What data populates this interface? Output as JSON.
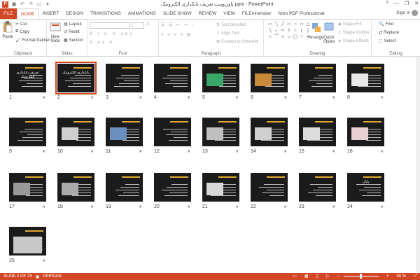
{
  "window": {
    "title": "پاورپوینت تعریف بانکداری الکترونیک.pptx - PowerPoint",
    "controls": [
      "?",
      "—",
      "❐",
      "✕"
    ]
  },
  "qat": [
    "save-icon",
    "undo-icon",
    "redo-icon",
    "start-slideshow-icon",
    "customize-icon"
  ],
  "tabs": [
    {
      "label": "FILE"
    },
    {
      "label": "HOME"
    },
    {
      "label": "INSERT"
    },
    {
      "label": "DESIGN"
    },
    {
      "label": "TRANSITIONS"
    },
    {
      "label": "ANIMATIONS"
    },
    {
      "label": "SLIDE SHOW"
    },
    {
      "label": "REVIEW"
    },
    {
      "label": "VIEW"
    },
    {
      "label": "FILEminimizer"
    },
    {
      "label": "Nitro PDF Professional"
    }
  ],
  "signin": "Sign in",
  "ribbon": {
    "clipboard": {
      "paste": "Paste",
      "cut": "Cut",
      "copy": "Copy",
      "format_painter": "Format Painter",
      "label": "Clipboard"
    },
    "slides": {
      "new_slide": "New Slide",
      "layout": "Layout",
      "reset": "Reset",
      "section": "Section",
      "label": "Slides"
    },
    "font": {
      "label": "Font"
    },
    "paragraph": {
      "text_direction": "Text Direction",
      "align_text": "Align Text",
      "convert": "Convert to SmartArt",
      "label": "Paragraph"
    },
    "drawing": {
      "arrange": "Arrange",
      "quick_styles": "Quick Styles",
      "shape_fill": "Shape Fill",
      "shape_outline": "Shape Outline",
      "shape_effects": "Shape Effects",
      "label": "Drawing"
    },
    "editing": {
      "find": "Find",
      "replace": "Replace",
      "select": "Select",
      "label": "Editing"
    }
  },
  "slides": [
    {
      "n": "1",
      "title": "تعریف بانکداری الکترونیک"
    },
    {
      "n": "2",
      "title": "بانکداری الکترونیک"
    },
    {
      "n": "3"
    },
    {
      "n": "4"
    },
    {
      "n": "5"
    },
    {
      "n": "6"
    },
    {
      "n": "7"
    },
    {
      "n": "8"
    },
    {
      "n": "9"
    },
    {
      "n": "10"
    },
    {
      "n": "11"
    },
    {
      "n": "12"
    },
    {
      "n": "13"
    },
    {
      "n": "14"
    },
    {
      "n": "15"
    },
    {
      "n": "16"
    },
    {
      "n": "17"
    },
    {
      "n": "18"
    },
    {
      "n": "19"
    },
    {
      "n": "20"
    },
    {
      "n": "21"
    },
    {
      "n": "22"
    },
    {
      "n": "23"
    },
    {
      "n": "24",
      "title": "پایان"
    },
    {
      "n": "25"
    }
  ],
  "selected_slide": 2,
  "status": {
    "slide_info": "SLIDE 2 OF 25",
    "language": "PERSIAN",
    "zoom": "50 %"
  },
  "colors": {
    "accent": "#d24726",
    "slide_bg": "#1b1b1b",
    "title_gold": "#e0a830"
  }
}
